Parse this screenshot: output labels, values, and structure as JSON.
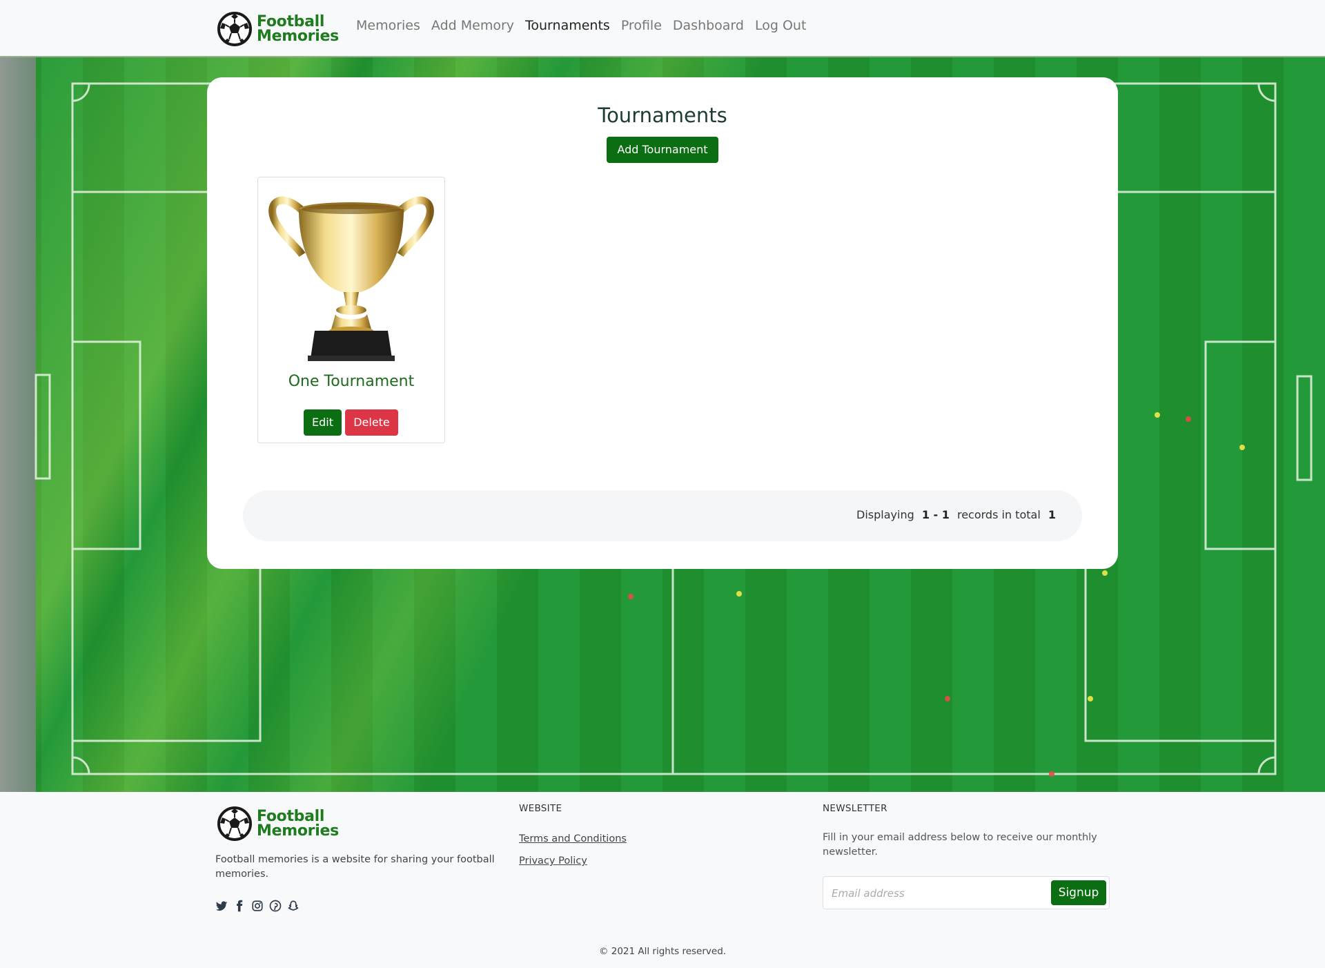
{
  "brand": {
    "line1": "Football",
    "line2": "Memories"
  },
  "nav": {
    "items": [
      {
        "label": "Memories",
        "active": false
      },
      {
        "label": "Add Memory",
        "active": false
      },
      {
        "label": "Tournaments",
        "active": true
      },
      {
        "label": "Profile",
        "active": false
      },
      {
        "label": "Dashboard",
        "active": false
      },
      {
        "label": "Log Out",
        "active": false
      }
    ]
  },
  "main": {
    "title": "Tournaments",
    "add_button": "Add Tournament",
    "tournaments": [
      {
        "name": "One Tournament",
        "edit_label": "Edit",
        "delete_label": "Delete"
      }
    ],
    "pagination": {
      "prefix": "Displaying",
      "range": "1 - 1",
      "middle": "records in total",
      "total": "1"
    }
  },
  "footer": {
    "brand": {
      "line1": "Football",
      "line2": "Memories"
    },
    "description": "Football memories is a website for sharing your football memories.",
    "socials": [
      "twitter-icon",
      "facebook-icon",
      "instagram-icon",
      "pinterest-icon",
      "snapchat-icon"
    ],
    "website": {
      "title": "WEBSITE",
      "links": [
        "Terms and Conditions",
        "Privacy Policy"
      ]
    },
    "newsletter": {
      "title": "NEWSLETTER",
      "text": "Fill in your email address below to receive our monthly newsletter.",
      "placeholder": "Email address",
      "button": "Signup"
    },
    "copyright": "© 2021 All rights reserved."
  },
  "colors": {
    "brand_green": "#1e7b1e",
    "button_green": "#0b6e12",
    "danger_red": "#dc3545",
    "pitch_green": "#1f8e2f"
  }
}
